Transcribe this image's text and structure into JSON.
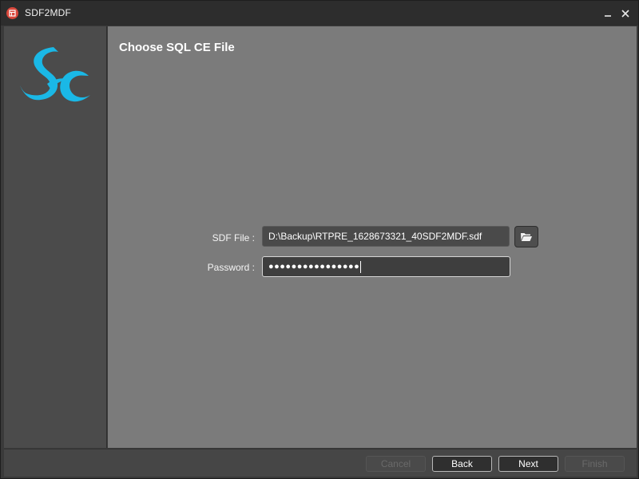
{
  "window": {
    "title": "SDF2MDF",
    "app_icon": "app-logo-icon",
    "minimize_icon": "minimize-icon",
    "close_icon": "close-icon"
  },
  "sidebar": {
    "logo_icon": "sc-logo-icon",
    "logo_color": "#1ab8e6"
  },
  "main": {
    "page_title": "Choose SQL CE File",
    "sdf_file": {
      "label": "SDF File :",
      "value": "D:\\Backup\\RTPRE_1628673321_40SDF2MDF.sdf",
      "browse_icon": "folder-open-icon"
    },
    "password": {
      "label": "Password :",
      "masked_value": "●●●●●●●●●●●●●●●●"
    }
  },
  "footer": {
    "cancel_label": "Cancel",
    "back_label": "Back",
    "next_label": "Next",
    "finish_label": "Finish",
    "cancel_enabled": false,
    "back_enabled": true,
    "next_enabled": true,
    "finish_enabled": false
  },
  "colors": {
    "content_bg": "#7b7b7b",
    "sidebar_bg": "#4b4b4b",
    "titlebar_bg": "#2d2d2d",
    "accent": "#1ab8e6"
  }
}
